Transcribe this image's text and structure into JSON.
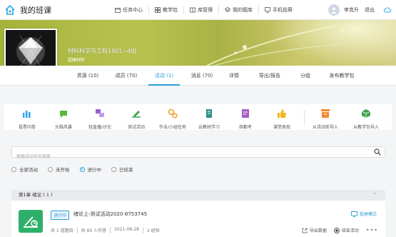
{
  "app": {
    "title": "我的班课"
  },
  "nav": {
    "items": [
      {
        "label": "任务中心",
        "icon": "calendar-icon"
      },
      {
        "label": "教学包",
        "icon": "grid-icon"
      },
      {
        "label": "库管理",
        "icon": "library-icon"
      },
      {
        "label": "我的题库",
        "icon": "stack-icon"
      },
      {
        "label": "手机投屏",
        "icon": "monitor-icon"
      }
    ]
  },
  "user": {
    "name": "李岚升",
    "logout": "退出",
    "icon": "cloud-icon"
  },
  "course": {
    "title": "材料科学与工程1901~4班",
    "subtitle": "超硬材料"
  },
  "tabs": [
    {
      "label": "资源 (10)",
      "active": false
    },
    {
      "label": "成员 (70)",
      "active": false
    },
    {
      "label": "活动 (1)",
      "active": true
    },
    {
      "label": "消息 (70)",
      "active": false
    },
    {
      "label": "详情",
      "active": false
    },
    {
      "label": "导出/报告",
      "active": false
    },
    {
      "label": "分组",
      "active": false
    },
    {
      "label": "发布教学包",
      "active": false
    }
  ],
  "toolbar": {
    "tools": [
      {
        "label": "投票问卷",
        "icon": "bar-chart-icon",
        "color": "#29a6e8"
      },
      {
        "label": "头脑风暴",
        "icon": "chat-bubble-icon",
        "color": "#58b83a"
      },
      {
        "label": "轻直播/讨论",
        "icon": "discussion-icon",
        "color": "#9a5fd0"
      },
      {
        "label": "测试活动",
        "icon": "pen-test-icon",
        "color": "#3ea34a"
      },
      {
        "label": "作业/小组任务",
        "icon": "gear-task-icon",
        "color": "#f0a22c"
      },
      {
        "label": "云教材学习",
        "icon": "book-icon",
        "color": "#2f8f8a"
      },
      {
        "label": "挑都考",
        "icon": "exam-icon",
        "color": "#a45fc8"
      },
      {
        "label": "课堂表现",
        "icon": "thumb-up-icon",
        "color": "#f2b51d"
      },
      {
        "label": "从活动库导入",
        "icon": "import-box-icon",
        "color": "#f08a2c"
      },
      {
        "label": "从教学包导入",
        "icon": "package-icon",
        "color": "#3ea34a"
      }
    ]
  },
  "search": {
    "placeholder": "根据活动名称搜索"
  },
  "filters": [
    {
      "label": "全部活动",
      "selected": false
    },
    {
      "label": "未开始",
      "selected": false
    },
    {
      "label": "进行中",
      "selected": true
    },
    {
      "label": "已结束",
      "selected": false
    }
  ],
  "chapter": {
    "label": "第1章 绪论 ( 1 )"
  },
  "activity": {
    "status": "进行中",
    "title": "绪论上-测试活动2020-8753745",
    "meta": [
      "共 1 道题目",
      "共 60 人作答",
      "2021-08-28",
      "2 经验"
    ],
    "screen_mode": "投屏模式",
    "export": "导出数据",
    "end": "结束活动"
  },
  "colors": {
    "accent": "#2a9bd6",
    "activity_icon": "#2fb06a"
  }
}
